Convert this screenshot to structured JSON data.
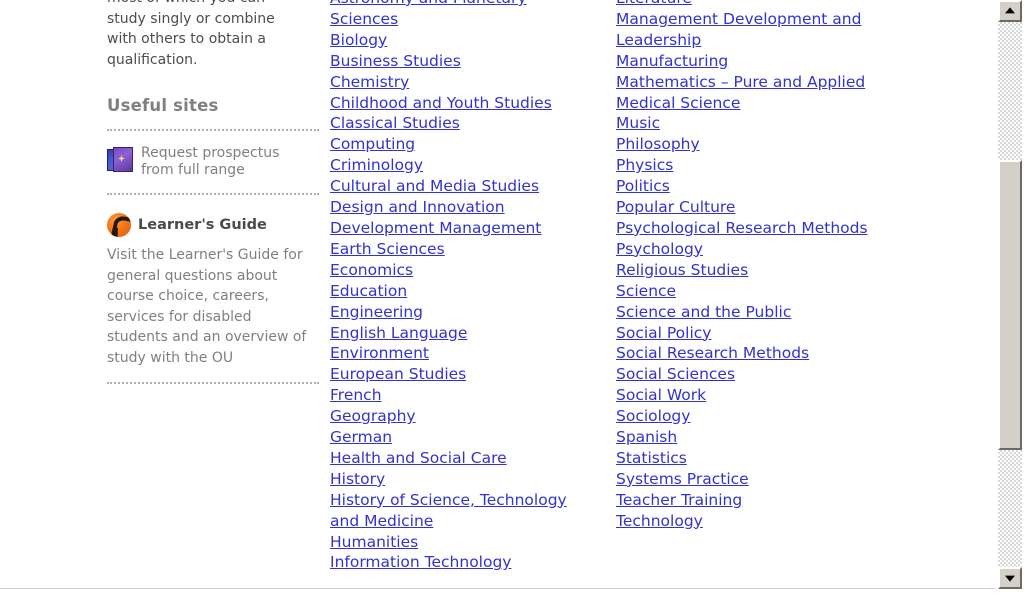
{
  "sidebar": {
    "intro_paragraph": "most of which you can\nstudy singly or combine\nwith others to obtain a\nqualification.",
    "useful_sites_heading": "Useful sites",
    "prospectus": {
      "icon": "prospectus-booklet-icon",
      "label": "Request prospectus\nfrom full range"
    },
    "learners_guide": {
      "icon": "ou-learners-guide-logo",
      "title": "Learner's Guide",
      "description": "Visit the Learner's Guide\nfor general questions\nabout course choice,\ncareers, services for\ndisabled students and an\noverview of study with the\nOU"
    }
  },
  "subjects": {
    "middle_column": [
      "Astronomy and Planetary\nSciences",
      "Biology",
      "Business Studies",
      "Chemistry",
      "Childhood and Youth Studies",
      "Classical Studies",
      "Computing",
      "Criminology",
      "Cultural and Media Studies",
      "Design and Innovation",
      "Development Management",
      "Earth Sciences",
      "Economics",
      "Education",
      "Engineering",
      "English Language",
      "Environment",
      "European Studies",
      "French",
      "Geography",
      "German",
      "Health and Social Care",
      "History",
      "History of Science, Technology\nand Medicine",
      "Humanities",
      "Information Technology"
    ],
    "right_column": [
      "Literature",
      "Management Development and\nLeadership",
      "Manufacturing",
      "Mathematics – Pure and Applied",
      "Medical Science",
      "Music",
      "Philosophy",
      "Physics",
      "Politics",
      "Popular Culture",
      "Psychological Research Methods",
      "Psychology",
      "Religious Studies",
      "Science",
      "Science and the Public",
      "Social Policy",
      "Social Research Methods",
      "Social Sciences",
      "Social Work",
      "Sociology",
      "Spanish",
      "Statistics",
      "Systems Practice",
      "Teacher Training",
      "Technology"
    ]
  },
  "scrollbar": {
    "up_icon": "triangle-up-icon",
    "down_icon": "triangle-down-icon"
  },
  "colors": {
    "link": "#3333CC",
    "sidebar_text": "#808080",
    "heading": "#808080",
    "logo_orange": "#F4761A",
    "scrollbar_face": "#D4D0C8"
  }
}
